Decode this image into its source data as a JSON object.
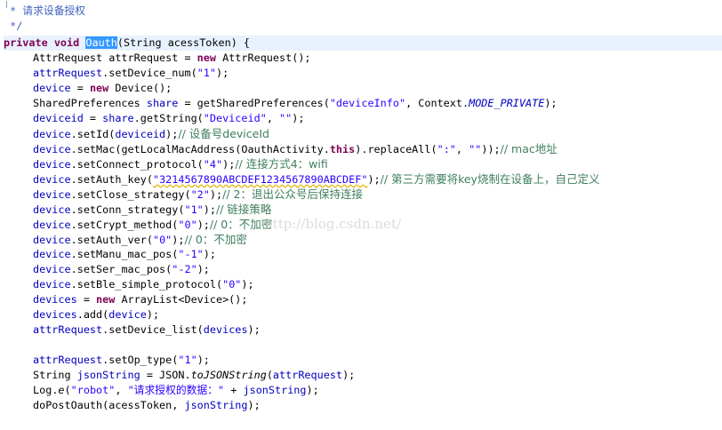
{
  "doc_comment": {
    "line1": " * 请求设备授权",
    "line2": " */"
  },
  "signature": {
    "kw_private": "private",
    "kw_void": "void",
    "method_name": "Oauth",
    "params": "(String acessToken) {"
  },
  "code": {
    "l1": {
      "a": "AttrRequest attrRequest = ",
      "kw": "new",
      "b": " AttrRequest();"
    },
    "l2": {
      "a": "attrRequest",
      "b": ".setDevice_num(",
      "s": "\"1\"",
      "c": ");"
    },
    "l3": {
      "a": "device",
      "b": " = ",
      "kw": "new",
      "c": " Device();"
    },
    "l4": {
      "a": "SharedPreferences ",
      "f": "share",
      "b": " = getSharedPreferences(",
      "s": "\"deviceInfo\"",
      "c": ", Context.",
      "i": "MODE_PRIVATE",
      "d": ");"
    },
    "l5": {
      "a": "deviceid",
      "b": " = ",
      "f": "share",
      "c": ".getString(",
      "s1": "\"Deviceid\"",
      "d": ", ",
      "s2": "\"\"",
      "e": ");"
    },
    "l6": {
      "a": "device",
      "b": ".setId(",
      "f": "deviceid",
      "c": ");",
      "cmt": "// 设备号deviceId"
    },
    "l7": {
      "a": "device",
      "b": ".setMac(getLocalMacAddress(OauthActivity.",
      "kw": "this",
      "c": ").replaceAll(",
      "s1": "\":\"",
      "d": ", ",
      "s2": "\"\"",
      "e": "));",
      "cmt": "// mac地址"
    },
    "l8": {
      "a": "device",
      "b": ".setConnect_protocol(",
      "s": "\"4\"",
      "c": ");",
      "cmt": "// 连接方式4：wifi"
    },
    "l9": {
      "a": "device",
      "b": ".setAuth_key(",
      "s": "\"3214567890ABCDEF1234567890ABCDEF\"",
      "c": ");",
      "cmt": "// 第三方需要将key烧制在设备上，自己定义"
    },
    "l10": {
      "a": "device",
      "b": ".setClose_strategy(",
      "s": "\"2\"",
      "c": ");",
      "cmt": "// 2：退出公众号后保持连接"
    },
    "l11": {
      "a": "device",
      "b": ".setConn_strategy(",
      "s": "\"1\"",
      "c": ");",
      "cmt": "// 链接策略"
    },
    "l12": {
      "a": "device",
      "b": ".setCrypt_method(",
      "s": "\"0\"",
      "c": ");",
      "cmt": "// 0：不加密"
    },
    "l13": {
      "a": "device",
      "b": ".setAuth_ver(",
      "s": "\"0\"",
      "c": ");",
      "cmt": "// 0：不加密"
    },
    "l14": {
      "a": "device",
      "b": ".setManu_mac_pos(",
      "s": "\"-1\"",
      "c": ");"
    },
    "l15": {
      "a": "device",
      "b": ".setSer_mac_pos(",
      "s": "\"-2\"",
      "c": ");"
    },
    "l16": {
      "a": "device",
      "b": ".setBle_simple_protocol(",
      "s": "\"0\"",
      "c": ");"
    },
    "l17": {
      "a": "devices",
      "b": " = ",
      "kw": "new",
      "c": " ArrayList<Device>();"
    },
    "l18": {
      "a": "devices",
      "b": ".add(",
      "f": "device",
      "c": ");"
    },
    "l19": {
      "a": "attrRequest",
      "b": ".setDevice_list(",
      "f": "devices",
      "c": ");"
    },
    "l20": {
      "a": "attrRequest",
      "b": ".setOp_type(",
      "s": "\"1\"",
      "c": ");"
    },
    "l21": {
      "a": "String ",
      "f": "jsonString",
      "b": " = JSON.",
      "m": "toJSONString",
      "c": "(",
      "f2": "attrRequest",
      "d": ");"
    },
    "l22": {
      "a": "Log.",
      "m": "e",
      "b": "(",
      "s1": "\"robot\"",
      "c": ", ",
      "s2": "\"请求授权的数据：\"",
      "d": " + ",
      "f": "jsonString",
      "e": ");"
    },
    "l23": {
      "a": "doPostOauth(acessToken, ",
      "f": "jsonString",
      "b": ");"
    }
  },
  "watermark": "http://blog.csdn.net/"
}
